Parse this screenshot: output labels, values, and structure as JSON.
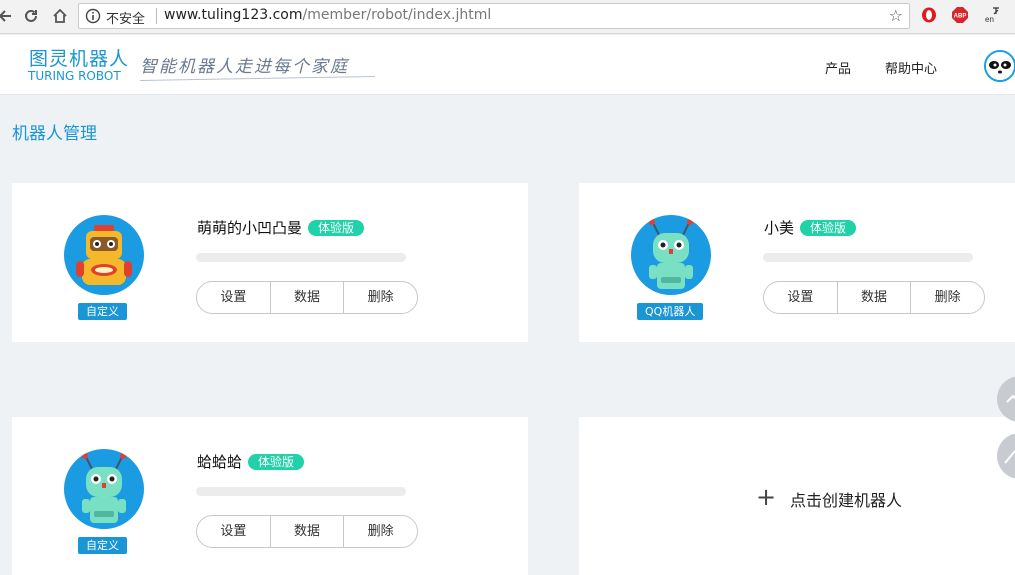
{
  "browser": {
    "security_label": "不安全",
    "url_host": "www.tuling123.com",
    "url_path": "/member/robot/index.jhtml",
    "ext_abp": "ABP",
    "ext_lang": "en"
  },
  "header": {
    "logo_cn": "图灵机器人",
    "logo_en": "TURING ROBOT",
    "slogan": "智能机器人走进每个家庭",
    "nav": [
      "产品",
      "帮助中心"
    ]
  },
  "page": {
    "title": "机器人管理"
  },
  "robots": [
    {
      "name": "萌萌的小凹凸曼",
      "badge": "体验版",
      "tag": "自定义",
      "actions": [
        "设置",
        "数据",
        "删除"
      ]
    },
    {
      "name": "小美",
      "badge": "体验版",
      "tag": "QQ机器人",
      "actions": [
        "设置",
        "数据",
        "删除"
      ]
    },
    {
      "name": "蛤蛤蛤",
      "badge": "体验版",
      "tag": "自定义",
      "actions": [
        "设置",
        "数据",
        "删除"
      ]
    }
  ],
  "create": {
    "icon": "plus-icon",
    "label": "点击创建机器人"
  },
  "colors": {
    "accent": "#1a95d6",
    "badge": "#21d1a7",
    "background": "#eff2f5"
  }
}
